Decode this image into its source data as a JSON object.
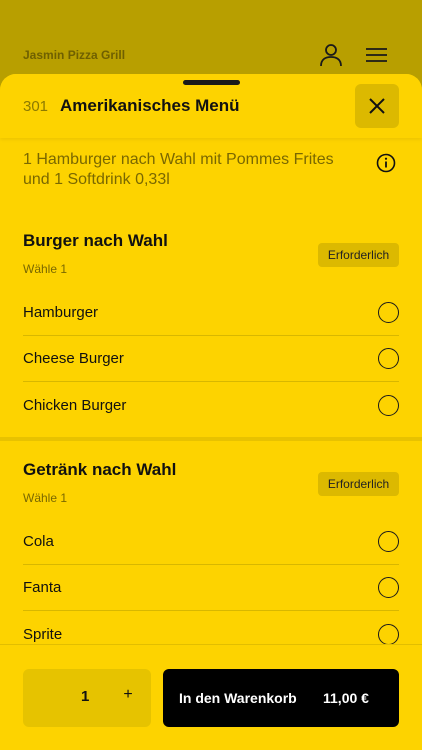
{
  "app": {
    "restaurant_name": "Jasmin Pizza Grill"
  },
  "item": {
    "number": "301",
    "title": "Amerikanisches Menü",
    "description": "1 Hamburger nach Wahl mit Pommes Frites und 1 Softdrink 0,33l"
  },
  "sections": [
    {
      "title": "Burger nach Wahl",
      "subtitle": "Wähle 1",
      "badge": "Erforderlich",
      "options": [
        "Hamburger",
        "Cheese Burger",
        "Chicken Burger"
      ]
    },
    {
      "title": "Getränk nach Wahl",
      "subtitle": "Wähle 1",
      "badge": "Erforderlich",
      "options": [
        "Cola",
        "Fanta",
        "Sprite"
      ]
    }
  ],
  "footer": {
    "quantity": "1",
    "plus_symbol": "+",
    "cart_label": "In den Warenkorb",
    "price": "11,00 €"
  },
  "icons": {
    "user": "user-icon",
    "menu": "hamburger-menu-icon",
    "close": "close-icon",
    "info": "info-icon"
  },
  "colors": {
    "accent": "#fdd300",
    "dark": "#000000"
  }
}
